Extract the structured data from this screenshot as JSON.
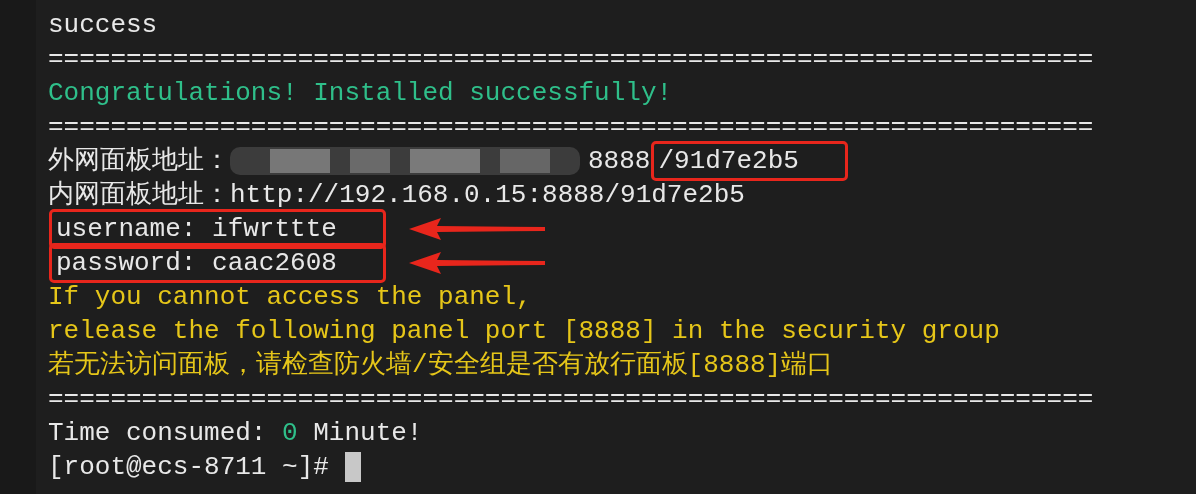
{
  "terminal": {
    "lines": [
      {
        "kind": "text",
        "segments": [
          {
            "text": "success",
            "color": "#e8e8e8",
            "highlighted": false
          }
        ]
      },
      {
        "kind": "rule",
        "segments": [
          {
            "text": "===================================================================",
            "color": "#e8e8e8",
            "highlighted": false
          }
        ]
      },
      {
        "kind": "text",
        "segments": [
          {
            "text": "Congratulations! Installed successfully!",
            "color": "#2fbf8a",
            "highlighted": false
          }
        ]
      },
      {
        "kind": "rule",
        "segments": [
          {
            "text": "===================================================================",
            "color": "#e8e8e8",
            "highlighted": false
          }
        ]
      },
      {
        "kind": "text",
        "segments": [
          {
            "text": "外网面板地址：",
            "color": "#e8e8e8",
            "highlighted": false
          },
          {
            "kind": "redacted"
          },
          {
            "text": "8888",
            "color": "#e8e8e8",
            "highlighted": false
          },
          {
            "text": "/91d7e2b5",
            "color": "#e8e8e8",
            "highlighted": true
          }
        ]
      },
      {
        "kind": "text",
        "segments": [
          {
            "text": "内网面板地址：http://192.168.0.15:8888/91d7e2b5",
            "color": "#e8e8e8",
            "highlighted": false
          }
        ]
      },
      {
        "kind": "text",
        "arrow": true,
        "segments": [
          {
            "text": "username: ifwrttte",
            "color": "#e8e8e8",
            "highlighted": true
          }
        ]
      },
      {
        "kind": "text",
        "arrow": true,
        "segments": [
          {
            "text": "password: caac2608",
            "color": "#e8e8e8",
            "highlighted": true
          }
        ]
      },
      {
        "kind": "text",
        "segments": [
          {
            "text": "If you cannot access the panel,",
            "color": "#e6c619",
            "highlighted": false
          }
        ]
      },
      {
        "kind": "text",
        "segments": [
          {
            "text": "release the following panel port [8888] in the security group",
            "color": "#e6c619",
            "highlighted": false
          }
        ]
      },
      {
        "kind": "text",
        "segments": [
          {
            "text": "若无法访问面板，请检查防火墙/安全组是否有放行面板[8888]端口",
            "color": "#e6c619",
            "highlighted": false
          }
        ]
      },
      {
        "kind": "rule",
        "segments": [
          {
            "text": "===================================================================",
            "color": "#e8e8e8",
            "highlighted": false
          }
        ]
      },
      {
        "kind": "text",
        "segments": [
          {
            "text": "Time consumed: ",
            "color": "#e8e8e8",
            "highlighted": false
          },
          {
            "text": "0",
            "color": "#2fbf8a",
            "highlighted": false
          },
          {
            "text": " Minute!",
            "color": "#e8e8e8",
            "highlighted": false
          }
        ]
      },
      {
        "kind": "prompt",
        "cursor": true,
        "segments": [
          {
            "text": "[root@ecs-8711 ~]#",
            "color": "#e8e8e8",
            "highlighted": false
          }
        ]
      }
    ]
  }
}
